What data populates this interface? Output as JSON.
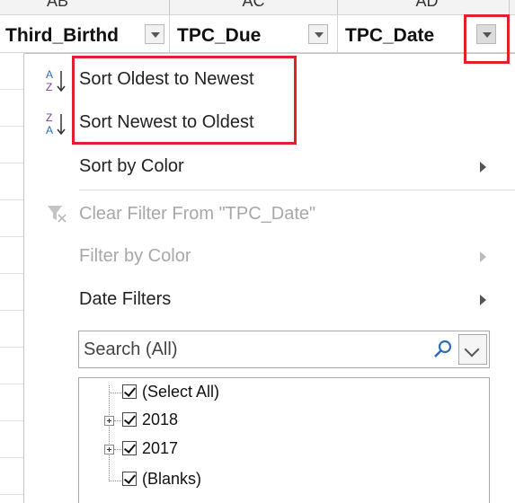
{
  "columns": [
    "AB",
    "AC",
    "AD"
  ],
  "headers": [
    {
      "text": "Third_Birthd"
    },
    {
      "text": "TPC_Due"
    },
    {
      "text": "TPC_Date"
    }
  ],
  "menu": {
    "sort_asc": "Sort Oldest to Newest",
    "sort_desc": "Sort Newest to Oldest",
    "sort_color": "Sort by Color",
    "clear_filter": "Clear Filter From \"TPC_Date\"",
    "filter_color": "Filter by Color",
    "date_filters": "Date Filters"
  },
  "search": {
    "placeholder": "Search (All)"
  },
  "tree": {
    "select_all": "(Select All)",
    "y2018": "2018",
    "y2017": "2017",
    "blanks": "(Blanks)"
  },
  "colors": {
    "highlight": "#e0202a"
  }
}
